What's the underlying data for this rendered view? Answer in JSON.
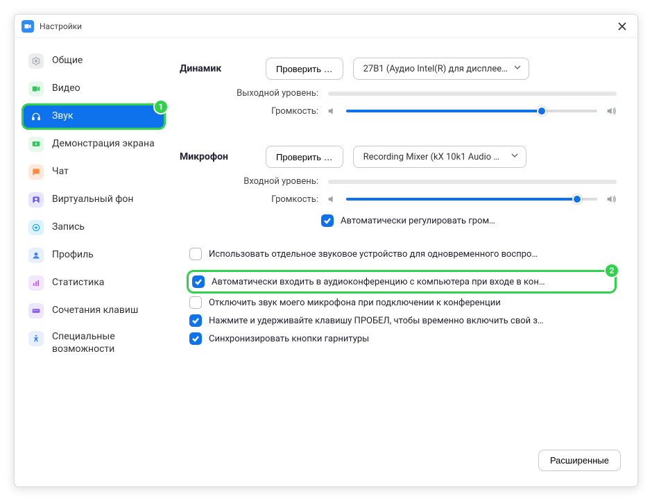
{
  "window": {
    "title": "Настройки"
  },
  "sidebar": {
    "items": [
      {
        "label": "Общие",
        "icon": "gear",
        "icon_bg": "#EDEDED",
        "icon_fg": "#9aa0a6"
      },
      {
        "label": "Видео",
        "icon": "video",
        "icon_bg": "#E7F8EC",
        "icon_fg": "#34c759"
      },
      {
        "label": "Звук",
        "icon": "headphones",
        "icon_bg": "#0E72ED",
        "icon_fg": "#ffffff",
        "active": true
      },
      {
        "label": "Демонстрация экрана",
        "icon": "share",
        "icon_bg": "#E7F8EC",
        "icon_fg": "#34c759"
      },
      {
        "label": "Чат",
        "icon": "chat",
        "icon_bg": "#FFE9DC",
        "icon_fg": "#ff8a3d"
      },
      {
        "label": "Виртуальный фон",
        "icon": "image",
        "icon_bg": "#E8E6FF",
        "icon_fg": "#6b5cff"
      },
      {
        "label": "Запись",
        "icon": "record",
        "icon_bg": "#DDF4FF",
        "icon_fg": "#1aa7ec"
      },
      {
        "label": "Профиль",
        "icon": "profile",
        "icon_bg": "#E6F0FF",
        "icon_fg": "#3b82f6"
      },
      {
        "label": "Статистика",
        "icon": "stats",
        "icon_bg": "#F4E6FF",
        "icon_fg": "#b25cff"
      },
      {
        "label": "Сочетания клавиш",
        "icon": "keyboard",
        "icon_bg": "#ECE6FF",
        "icon_fg": "#8b5cf6"
      },
      {
        "label": "Специальные возможности",
        "icon": "access",
        "icon_bg": "#E6F0FF",
        "icon_fg": "#3b82f6"
      }
    ]
  },
  "badges": {
    "one": "1",
    "two": "2"
  },
  "speaker": {
    "title": "Динамик",
    "test": "Проверить …",
    "device": "27B1 (Аудио Intel(R) для дисплее…",
    "output_level": "Выходной уровень:",
    "volume_label": "Громкость:",
    "volume_pct": 78
  },
  "mic": {
    "title": "Микрофон",
    "test": "Проверить …",
    "device": "Recording Mixer (kX 10k1 Audio …",
    "input_level": "Входной уровень:",
    "volume_label": "Громкость:",
    "volume_pct": 92,
    "auto_label": "Автоматически регулировать гром…"
  },
  "options": {
    "separate": "Использовать отдельное звуковое устройство для одновременного воспро…",
    "auto_join": "Автоматически входить в аудиоконференцию с компьютера при входе в кон…",
    "mute_on_join": "Отключить звук моего микрофона при подключении к конференции",
    "space_unmute": "Нажмите и удерживайте клавишу ПРОБЕЛ, чтобы временно включить свой з…",
    "sync_headset": "Синхронизировать кнопки гарнитуры"
  },
  "advanced": "Расширенные"
}
